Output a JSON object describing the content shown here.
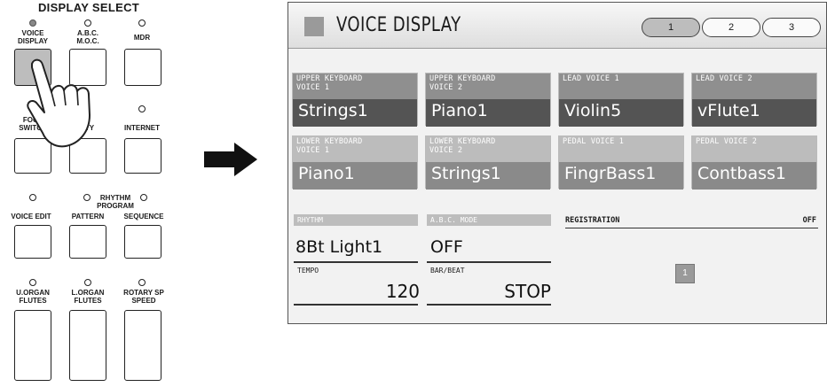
{
  "panel": {
    "title": "DISPLAY SELECT",
    "buttons": {
      "voice_display": "VOICE\nDISPLAY",
      "abc_moc": "A.B.C.\nM.O.C.",
      "mdr": "MDR",
      "footswitch": "FOOT\nSWITCH",
      "utility": "TY",
      "internet": "INTERNET",
      "rhythm_program": "RHYTHM\nPROGRAM",
      "voice_edit": "VOICE EDIT",
      "pattern": "PATTERN",
      "sequence": "SEQUENCE",
      "u_organ_flutes": "U.ORGAN\nFLUTES",
      "l_organ_flutes": "L.ORGAN\nFLUTES",
      "rotary_sp_speed": "ROTARY SP\nSPEED"
    }
  },
  "screen": {
    "title": "VOICE DISPLAY",
    "tabs": [
      "1",
      "2",
      "3"
    ],
    "active_tab": "1",
    "voices": [
      {
        "label1": "UPPER KEYBOARD",
        "label2": "VOICE 1",
        "name": "Strings1"
      },
      {
        "label1": "UPPER KEYBOARD",
        "label2": "VOICE 2",
        "name": "Piano1"
      },
      {
        "label1": "LEAD VOICE 1",
        "label2": "",
        "name": "Violin5"
      },
      {
        "label1": "LEAD VOICE 2",
        "label2": "",
        "name": "vFlute1"
      },
      {
        "label1": "LOWER KEYBOARD",
        "label2": "VOICE 1",
        "name": "Piano1"
      },
      {
        "label1": "LOWER KEYBOARD",
        "label2": "VOICE 2",
        "name": "Strings1"
      },
      {
        "label1": "PEDAL VOICE 1",
        "label2": "",
        "name": "FingrBass1"
      },
      {
        "label1": "PEDAL VOICE 2",
        "label2": "",
        "name": "Contbass1"
      }
    ],
    "rhythm": {
      "label": "RHYTHM",
      "value": "8Bt Light1"
    },
    "abc_mode": {
      "label": "A.B.C. MODE",
      "value": "OFF"
    },
    "tempo": {
      "label": "TEMPO",
      "value": "120"
    },
    "bar_beat": {
      "label": "BAR/BEAT",
      "value": "STOP"
    },
    "registration": {
      "label": "REGISTRATION",
      "status": "OFF",
      "number": "1"
    }
  }
}
